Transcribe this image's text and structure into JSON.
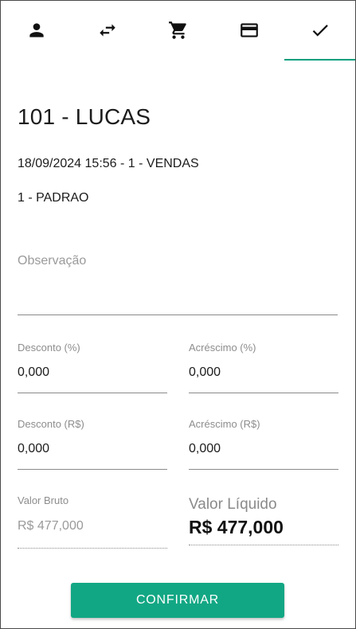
{
  "tabs": [
    {
      "icon": "person-icon",
      "active": false
    },
    {
      "icon": "swap-arrows-icon",
      "active": false
    },
    {
      "icon": "cart-icon",
      "active": false
    },
    {
      "icon": "credit-card-icon",
      "active": false
    },
    {
      "icon": "check-icon",
      "active": true
    }
  ],
  "header": {
    "title": "101 - LUCAS",
    "line1": "18/09/2024 15:56 - 1 - VENDAS",
    "line2": "1 - PADRAO"
  },
  "observacao": {
    "placeholder": "Observação",
    "value": ""
  },
  "fields": {
    "desconto_pct": {
      "label": "Desconto (%)",
      "value": "0,000"
    },
    "acrescimo_pct": {
      "label": "Acréscimo (%)",
      "value": "0,000"
    },
    "desconto_rs": {
      "label": "Desconto (R$)",
      "value": "0,000"
    },
    "acrescimo_rs": {
      "label": "Acréscimo (R$)",
      "value": "0,000"
    }
  },
  "totals": {
    "bruto_label": "Valor Bruto",
    "bruto_value": "R$ 477,000",
    "liquido_label": "Valor Líquido",
    "liquido_value": "R$ 477,000"
  },
  "actions": {
    "confirm_label": "CONFIRMAR"
  },
  "colors": {
    "accent": "#12a784",
    "tab_indicator": "#009e7e"
  }
}
